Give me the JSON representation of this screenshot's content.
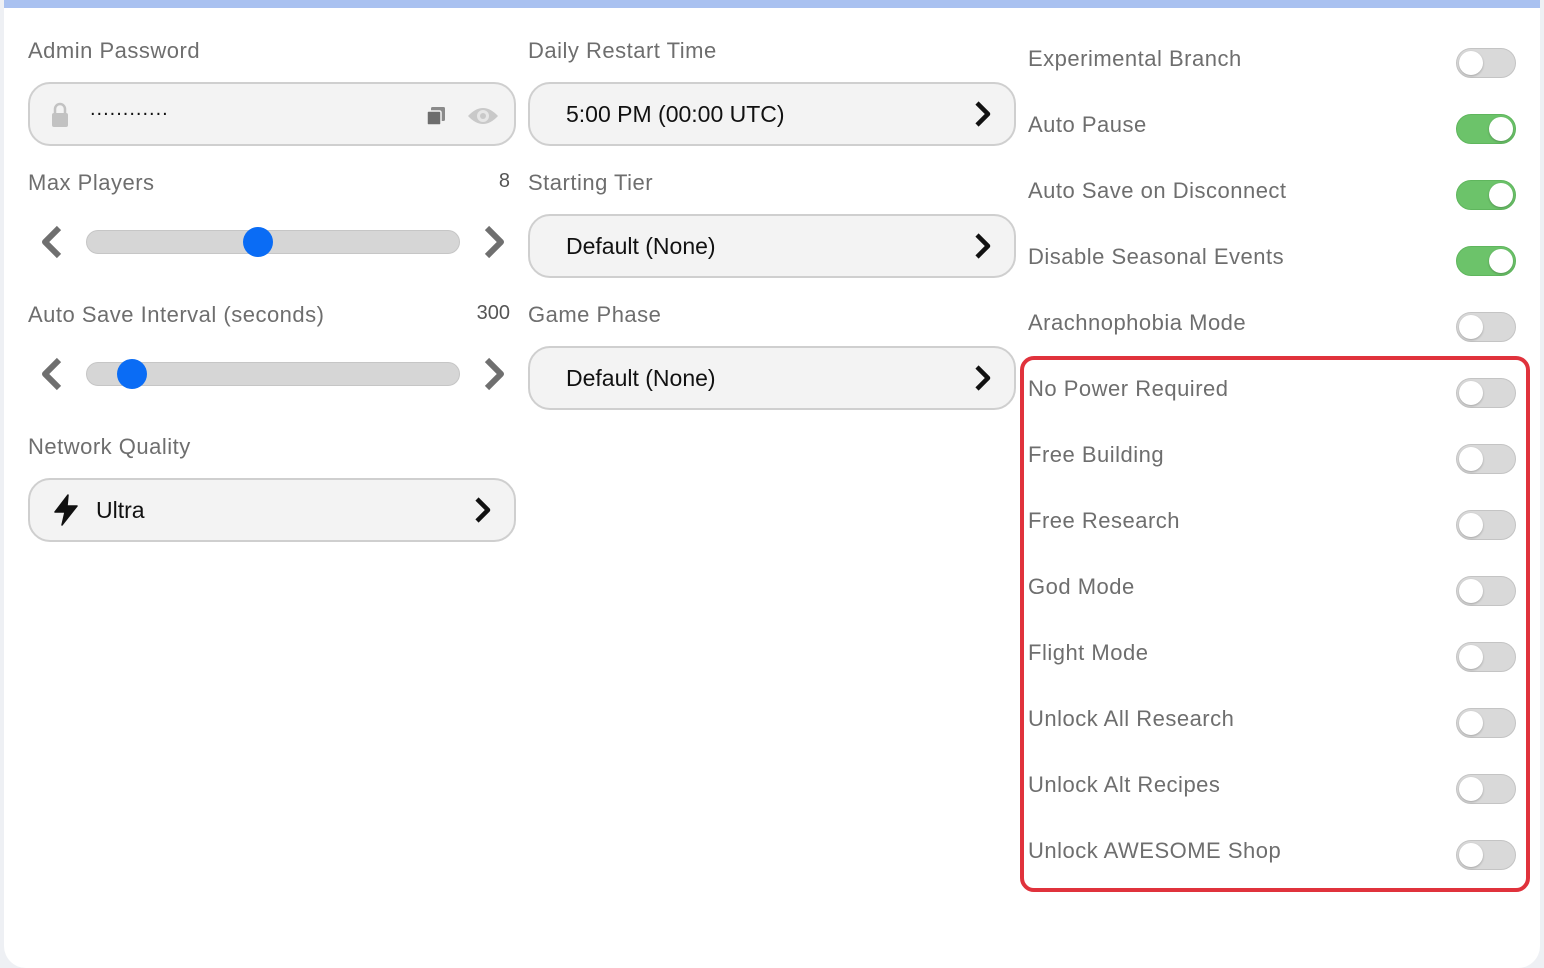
{
  "colors": {
    "accent": "#0a6cf5",
    "toggle_on": "#6cc36a",
    "toggle_off": "#d9d9d9",
    "highlight": "#e0323c",
    "top_bar": "#a9c1f0"
  },
  "admin_password": {
    "label": "Admin Password",
    "value": "............",
    "lock_icon": "lock-icon",
    "copy_icon": "copy-icon",
    "eye_icon": "eye-icon"
  },
  "max_players": {
    "label": "Max Players",
    "value": "8",
    "level": 0.46
  },
  "auto_save_interval": {
    "label": "Auto Save Interval (seconds)",
    "value": "300",
    "level": 0.12
  },
  "network_quality": {
    "label": "Network Quality",
    "value": "Ultra",
    "icon": "lightning-icon"
  },
  "daily_restart": {
    "label": "Daily Restart Time",
    "value": "5:00 PM (00:00 UTC)"
  },
  "starting_tier": {
    "label": "Starting Tier",
    "value": "Default (None)"
  },
  "game_phase": {
    "label": "Game Phase",
    "value": "Default (None)"
  },
  "toggles": [
    {
      "label": "Experimental Branch",
      "on": false
    },
    {
      "label": "Auto Pause",
      "on": true
    },
    {
      "label": "Auto Save on Disconnect",
      "on": true
    },
    {
      "label": "Disable Seasonal Events",
      "on": true
    },
    {
      "label": "Arachnophobia Mode",
      "on": false
    },
    {
      "label": "No Power Required",
      "on": false
    },
    {
      "label": "Free Building",
      "on": false
    },
    {
      "label": "Free Research",
      "on": false
    },
    {
      "label": "God Mode",
      "on": false
    },
    {
      "label": "Flight Mode",
      "on": false
    },
    {
      "label": "Unlock All Research",
      "on": false
    },
    {
      "label": "Unlock Alt Recipes",
      "on": false
    },
    {
      "label": "Unlock AWESOME Shop",
      "on": false
    }
  ]
}
